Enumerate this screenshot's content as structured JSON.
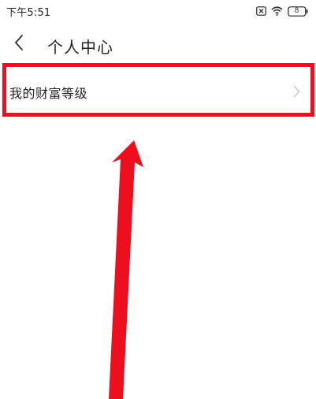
{
  "status_bar": {
    "time": "下午5:51",
    "battery_level": "8",
    "icons": [
      "sim-x-icon",
      "wifi-icon",
      "battery-icon"
    ]
  },
  "header": {
    "back_icon": "chevron-left-icon",
    "title": "个人中心"
  },
  "menu": {
    "items": [
      {
        "label": "我的财富等级",
        "icon": "chevron-right-icon"
      }
    ]
  },
  "annotation": {
    "highlight_color": "#ee0f1e"
  }
}
